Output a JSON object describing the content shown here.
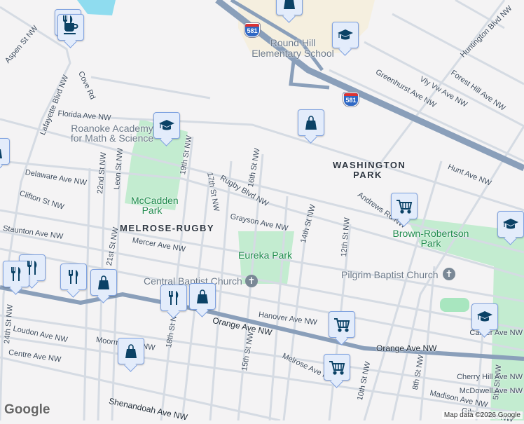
{
  "map": {
    "neighborhoods": [
      "MELROSE-RUGBY",
      "WASHINGTON PARK"
    ],
    "parks": [
      "McCadden Park",
      "Eureka Park",
      "Brown-Robertson Park"
    ],
    "pois": [
      "Round Hill Elementary School",
      "Roanoke Academy for Math & Science",
      "Central Baptist Church",
      "Pilgrim Baptist Church"
    ],
    "highway_shield": "581",
    "streets": [
      "Lafayette Blvd NW",
      "Aspen St NW",
      "Cove Rd",
      "Florida Ave NW",
      "Delaware Ave NW",
      "Clifton St NW",
      "22nd St NW",
      "Leon St NW",
      "19th St NW",
      "17th St NW",
      "Rugby Blvd NW",
      "16th St NW",
      "Grayson Ave NW",
      "14th St NW",
      "12th St NW",
      "10th St NW",
      "Greenhurst Ave NW",
      "Vly Vw Ave NW",
      "Forest Hill Ave NW",
      "Huntington Blvd NW",
      "Hunt Ave NW",
      "Andrews Rd NW",
      "Staunton Ave NW",
      "Mercer Ave NW",
      "Hanover Ave NW",
      "Orange Ave NW",
      "21st St NW",
      "24th St NW",
      "18th St NW",
      "15th St NW",
      "Loudon Ave NW",
      "Centre Ave NW",
      "Moorman Rd NW",
      "Shenandoah Ave NW",
      "Melrose Ave NW",
      "8th St NW",
      "5th St NW",
      "Madison Ave NW",
      "Carver Ave NW",
      "Cherry Hill Ave NW",
      "McDowell Ave NW",
      "Gilmer Ave NW"
    ],
    "markers": [
      "restaurant",
      "coffee",
      "shopping",
      "school",
      "shopping",
      "school",
      "shopping",
      "grocery",
      "school",
      "restaurant",
      "restaurant",
      "restaurant",
      "shopping",
      "restaurant",
      "shopping",
      "shopping",
      "grocery",
      "grocery",
      "school"
    ],
    "attribution": "Map data ©2026 Google",
    "logo": "Google",
    "colors": {
      "park": "#c3ecd0",
      "highway": "#8a9fba",
      "road": "#d5dbe3",
      "marker_bg": "#e3ecfb",
      "icon": "#0b4266"
    }
  }
}
